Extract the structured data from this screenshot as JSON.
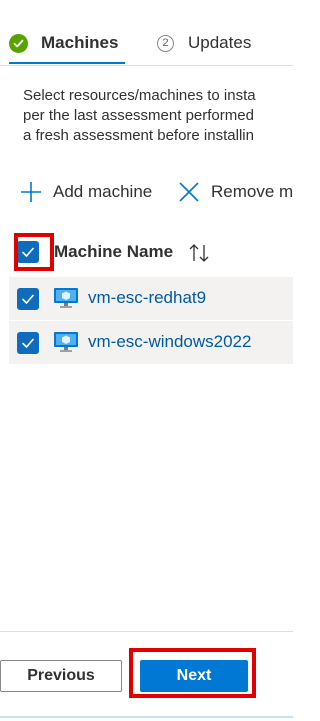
{
  "tabs": [
    {
      "label": "Machines",
      "status": "complete",
      "icon": "check-circle-icon"
    },
    {
      "label": "Updates",
      "step_number": "2",
      "icon": "step-number-icon"
    }
  ],
  "description": {
    "lines": [
      "Select resources/machines to insta",
      "per the last assessment performed",
      "a fresh assessment before installin"
    ]
  },
  "toolbar": {
    "add_label": "Add machine",
    "remove_label": "Remove m"
  },
  "grid": {
    "header_label": "Machine Name",
    "header_checked": true,
    "rows": [
      {
        "name": "vm-esc-redhat9",
        "checked": true
      },
      {
        "name": "vm-esc-windows2022",
        "checked": true
      }
    ]
  },
  "footer": {
    "previous_label": "Previous",
    "next_label": "Next"
  },
  "colors": {
    "accent": "#0078d4",
    "checkbox": "#0f6cbd",
    "success": "#57a300",
    "highlight": "#e00000",
    "link": "#005a9e"
  }
}
